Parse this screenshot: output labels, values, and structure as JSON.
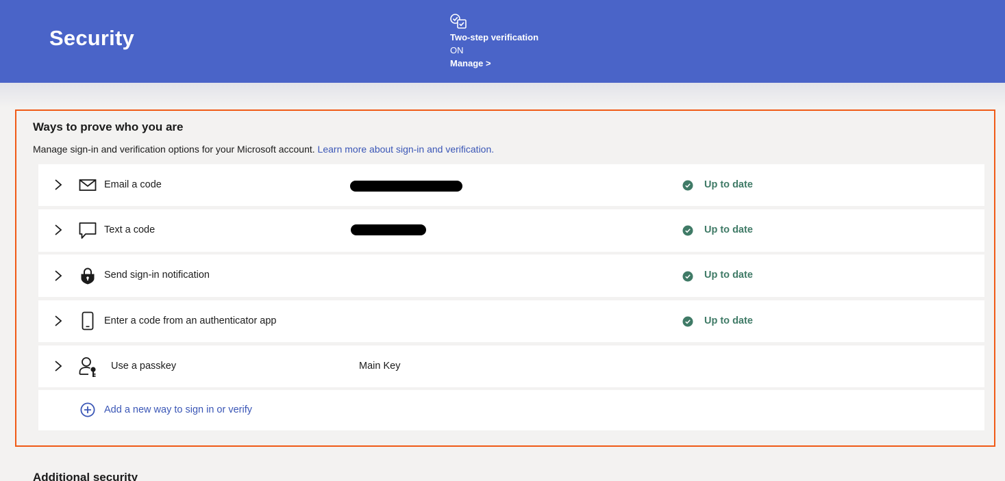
{
  "header": {
    "title": "Security",
    "two_step": {
      "title": "Two-step verification",
      "status": "ON",
      "manage_label": "Manage >"
    },
    "bg_color": "#4a64c8"
  },
  "section": {
    "title": "Ways to prove who you are",
    "description": "Manage sign-in and verification options for your Microsoft account.",
    "learn_more": "Learn more about sign-in and verification.",
    "highlight_color": "#f05a16",
    "methods": [
      {
        "label": "Email a code",
        "icon": "mail-icon",
        "detail": "",
        "detail_redacted": true,
        "status": "Up to date"
      },
      {
        "label": "Text a code",
        "icon": "chat-bubble-icon",
        "detail": "",
        "detail_redacted": true,
        "status": "Up to date"
      },
      {
        "label": "Send sign-in notification",
        "icon": "lock-shield-icon",
        "detail": "",
        "detail_redacted": false,
        "status": "Up to date"
      },
      {
        "label": "Enter a code from an authenticator app",
        "icon": "phone-icon",
        "detail": "",
        "detail_redacted": false,
        "status": "Up to date"
      },
      {
        "label": "Use a passkey",
        "icon": "passkey-icon",
        "detail": "Main Key",
        "detail_redacted": false,
        "status": ""
      }
    ],
    "add_label": "Add a new way to sign in or verify",
    "status_color": "#3f7a66"
  },
  "next_section": {
    "title": "Additional security"
  }
}
